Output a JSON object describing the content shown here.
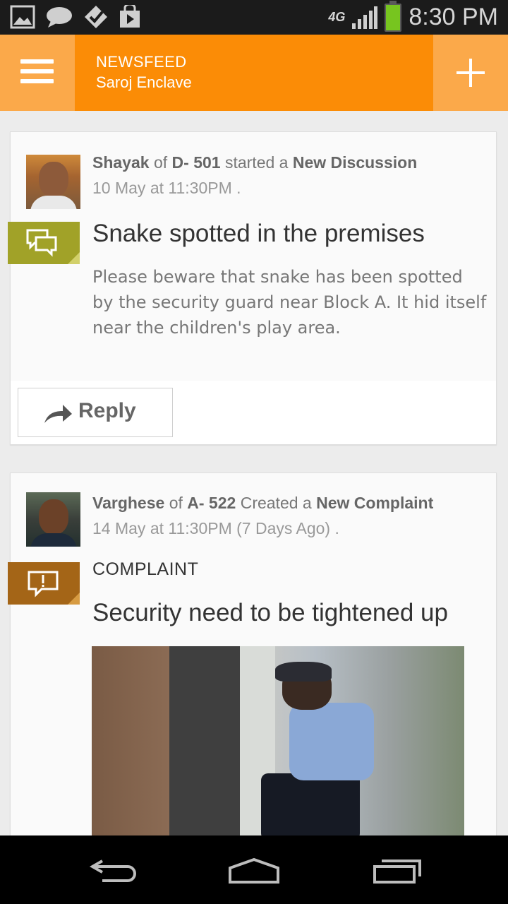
{
  "status_bar": {
    "time": "8:30 PM",
    "network": "4G",
    "icons": [
      "gallery-icon",
      "chat-icon",
      "checkmark-icon",
      "play-store-icon"
    ]
  },
  "action_bar": {
    "title": "NEWSFEED",
    "subtitle": "Saroj Enclave"
  },
  "posts": [
    {
      "author": "Shayak",
      "of_word": "of",
      "unit": "D- 501",
      "action": "started a",
      "type": "New Discussion",
      "date": "10 May  at 11:30PM .",
      "title": "Snake spotted in the premises",
      "body": "Please beware that snake has been spotted by the security guard near Block A. It hid itself near the children's play area.",
      "reply_label": "Reply",
      "tag_icon": "discussion-icon",
      "tag_color": "#a1a228"
    },
    {
      "author": "Varghese",
      "of_word": "of",
      "unit": "A- 522",
      "action": "Created a",
      "type": "New Complaint",
      "date": "14 May  at 11:30PM (7 Days Ago)  .",
      "category": "COMPLAINT",
      "title": "Security need to be tightened up",
      "tag_icon": "complaint-icon",
      "tag_color": "#a46517"
    }
  ],
  "colors": {
    "accent": "#fb8c06",
    "accent_light": "#fba94a"
  }
}
